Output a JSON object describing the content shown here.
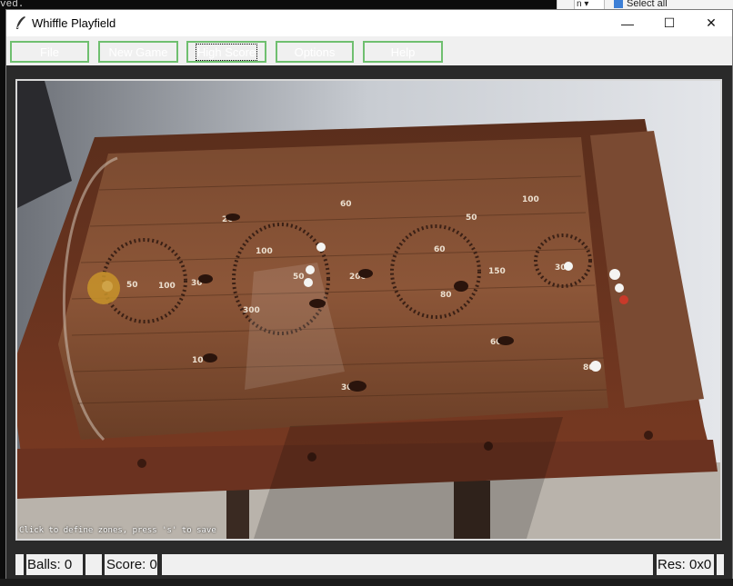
{
  "background": {
    "terminal_text": "ved.",
    "dropdown_value": "n",
    "select_all": "Select all"
  },
  "window": {
    "title": "Whiffle Playfield",
    "controls": {
      "minimize": "—",
      "maximize": "☐",
      "close": "✕"
    }
  },
  "menu": {
    "file": "File",
    "new_game": "New Game",
    "high_score": "High Score",
    "options": "Options",
    "help": "Help"
  },
  "canvas": {
    "hint": "Click to define zones, press 's' to save",
    "board_labels": {
      "l20": "20",
      "l60a": "60",
      "l100a": "100",
      "l50a": "50",
      "l100b": "100",
      "l60b": "60",
      "l50b": "50",
      "l200": "200",
      "l150": "150",
      "l300a": "300",
      "l50c": "50",
      "l100c": "100",
      "l30a": "30",
      "l300b": "300",
      "l80a": "80",
      "l10": "10",
      "l60c": "60",
      "l80b": "80",
      "l30b": "30"
    }
  },
  "status": {
    "balls": "Balls: 0",
    "score": "Score: 0",
    "res": "Res: 0x0"
  },
  "colors": {
    "accent_border": "#6fbf6f",
    "status_bar_bg": "#2a2a2a"
  }
}
